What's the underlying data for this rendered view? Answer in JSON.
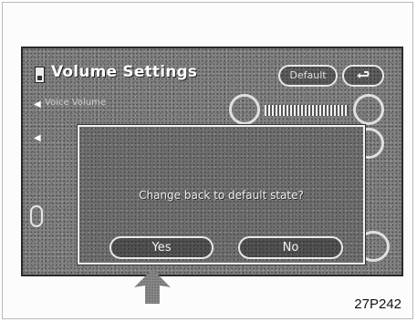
{
  "screen": {
    "title": "Volume Settings",
    "default_button": "Default",
    "back_icon": "return-arrow-icon",
    "row1_label": "Voice Volume",
    "dialog": {
      "message": "Change back to default state?",
      "yes_label": "Yes",
      "no_label": "No"
    }
  },
  "figure": {
    "pointer_icon": "up-arrow-pointer-icon",
    "caption": "27P242"
  }
}
